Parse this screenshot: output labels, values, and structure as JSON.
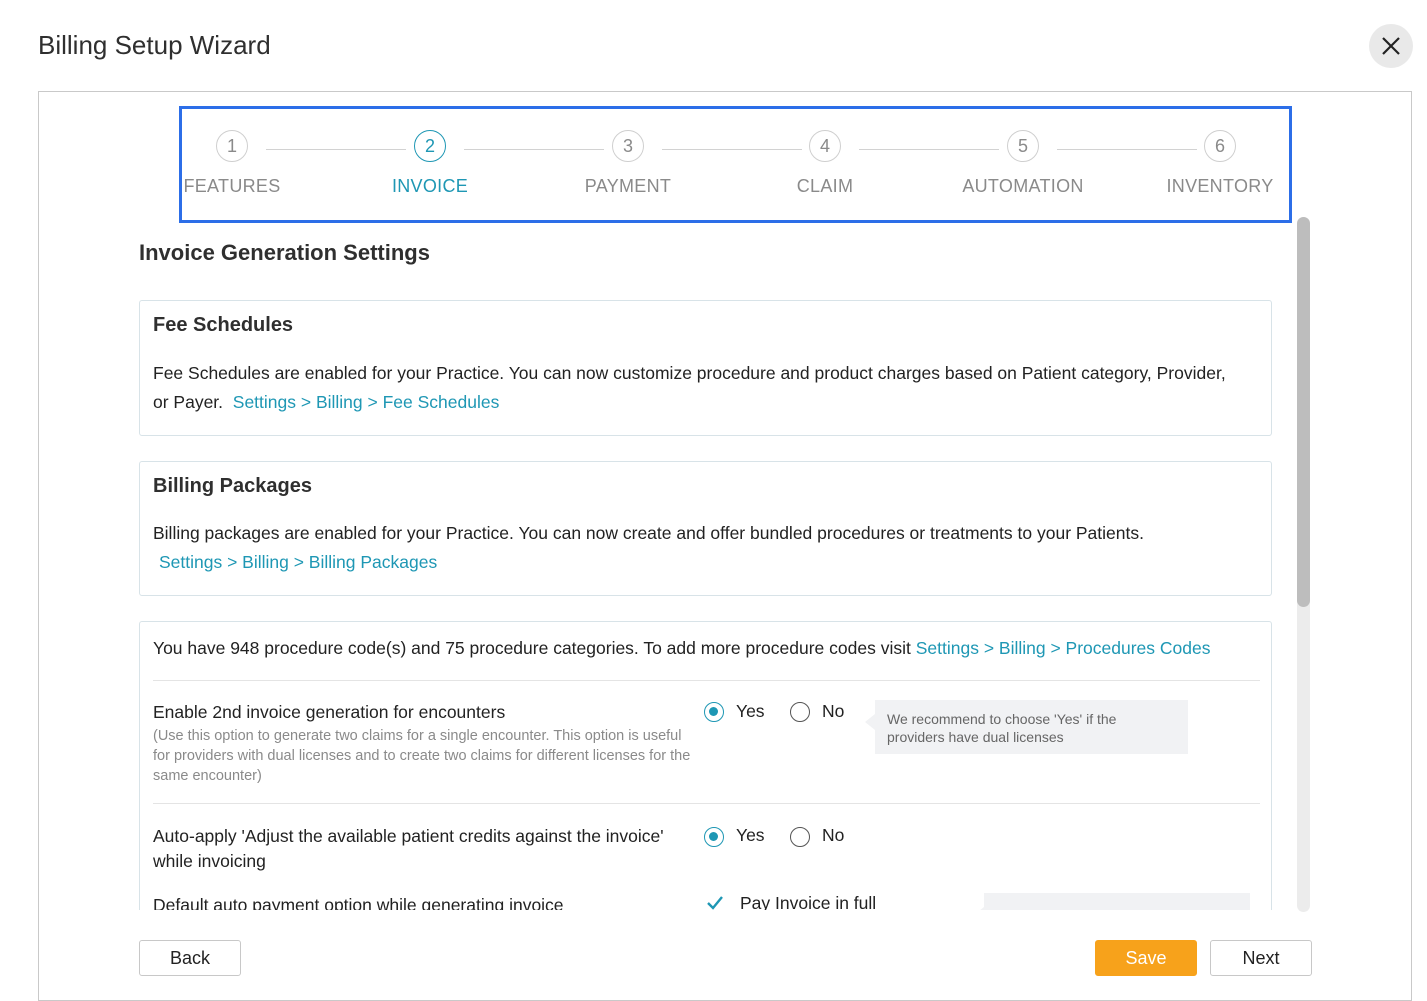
{
  "window": {
    "title": "Billing Setup Wizard"
  },
  "steps": [
    {
      "number": "1",
      "label": "FEATURES"
    },
    {
      "number": "2",
      "label": "INVOICE",
      "active": true
    },
    {
      "number": "3",
      "label": "PAYMENT"
    },
    {
      "number": "4",
      "label": "CLAIM"
    },
    {
      "number": "5",
      "label": "AUTOMATION"
    },
    {
      "number": "6",
      "label": "INVENTORY"
    }
  ],
  "main": {
    "heading": "Invoice Generation Settings",
    "fee_schedules": {
      "title": "Fee Schedules",
      "text": "Fee Schedules are enabled for your Practice. You can now customize procedure and product charges based on Patient category, Provider, or Payer.",
      "link": "Settings > Billing > Fee Schedules"
    },
    "billing_packages": {
      "title": "Billing Packages",
      "text": "Billing packages are enabled for your Practice. You can now create and offer bundled procedures or treatments to your Patients.",
      "link": "Settings > Billing > Billing Packages"
    },
    "procedures": {
      "text": "You have 948 procedure code(s) and 75 procedure categories. To add more procedure codes visit",
      "link": "Settings > Billing > Procedures Codes"
    },
    "second_invoice": {
      "label": "Enable 2nd invoice generation for encounters",
      "help": "(Use this option to generate two claims for a single encounter. This option is useful for providers with dual licenses and to create two claims for different licenses for the same encounter)",
      "yes": "Yes",
      "no": "No",
      "selected": "Yes",
      "tip": "We recommend to choose 'Yes' if the providers have dual licenses"
    },
    "auto_apply": {
      "label": "Auto-apply 'Adjust the available patient credits against the invoice' while invoicing",
      "yes": "Yes",
      "no": "No",
      "selected": "Yes"
    },
    "default_payment": {
      "label": "Default auto payment option while generating invoice",
      "option": "Pay Invoice in full",
      "checked": true
    }
  },
  "footer": {
    "back": "Back",
    "save": "Save",
    "next": "Next"
  },
  "colors": {
    "accent": "#1e97b4",
    "primary_button": "#f7a21b",
    "highlight_border": "#2c6ee8"
  }
}
